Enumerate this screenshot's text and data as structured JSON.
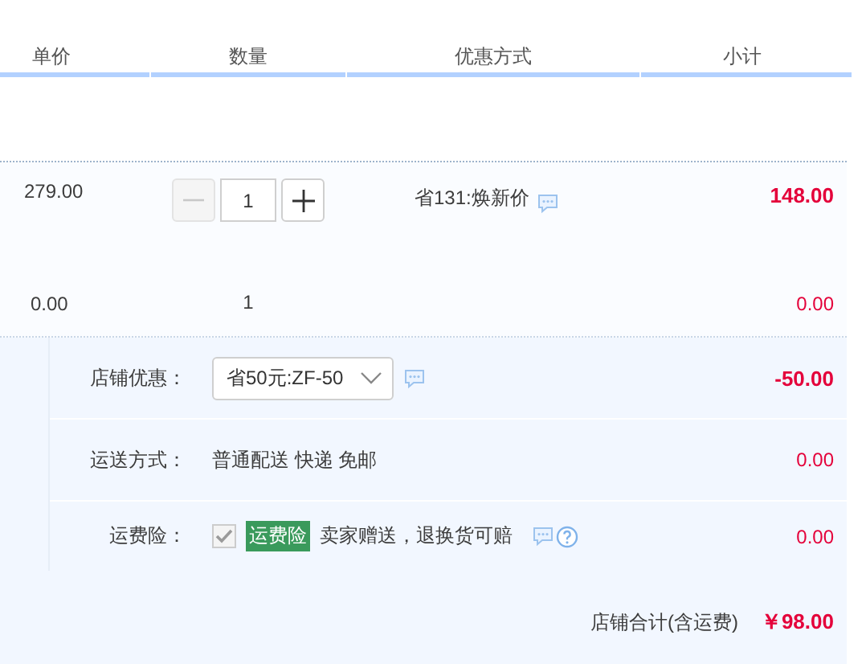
{
  "columns": [
    "单价",
    "数量",
    "优惠方式",
    "小计"
  ],
  "items": [
    {
      "kind": "stepper",
      "price": "279.00",
      "quantity": "1",
      "minus_disabled": true,
      "promotion": "省131:焕新价",
      "subtotal": "148.00"
    },
    {
      "kind": "plain",
      "price": "0.00",
      "quantity": "1",
      "subtotal": "0.00"
    }
  ],
  "shop_options": [
    {
      "kind": "select",
      "label": "店铺优惠：",
      "value": "省50元:ZF-50",
      "amount": "-50.00"
    },
    {
      "kind": "text",
      "label": "运送方式：",
      "value": "普通配送 快递 免邮",
      "amount": "0.00"
    },
    {
      "kind": "insurance",
      "label": "运费险：",
      "checked": true,
      "disabled": true,
      "badge": "运费险",
      "value": "卖家赠送，退换货可赔",
      "amount": "0.00"
    }
  ],
  "total": {
    "label": "店铺合计(含运费)",
    "amount": "￥98.00"
  }
}
